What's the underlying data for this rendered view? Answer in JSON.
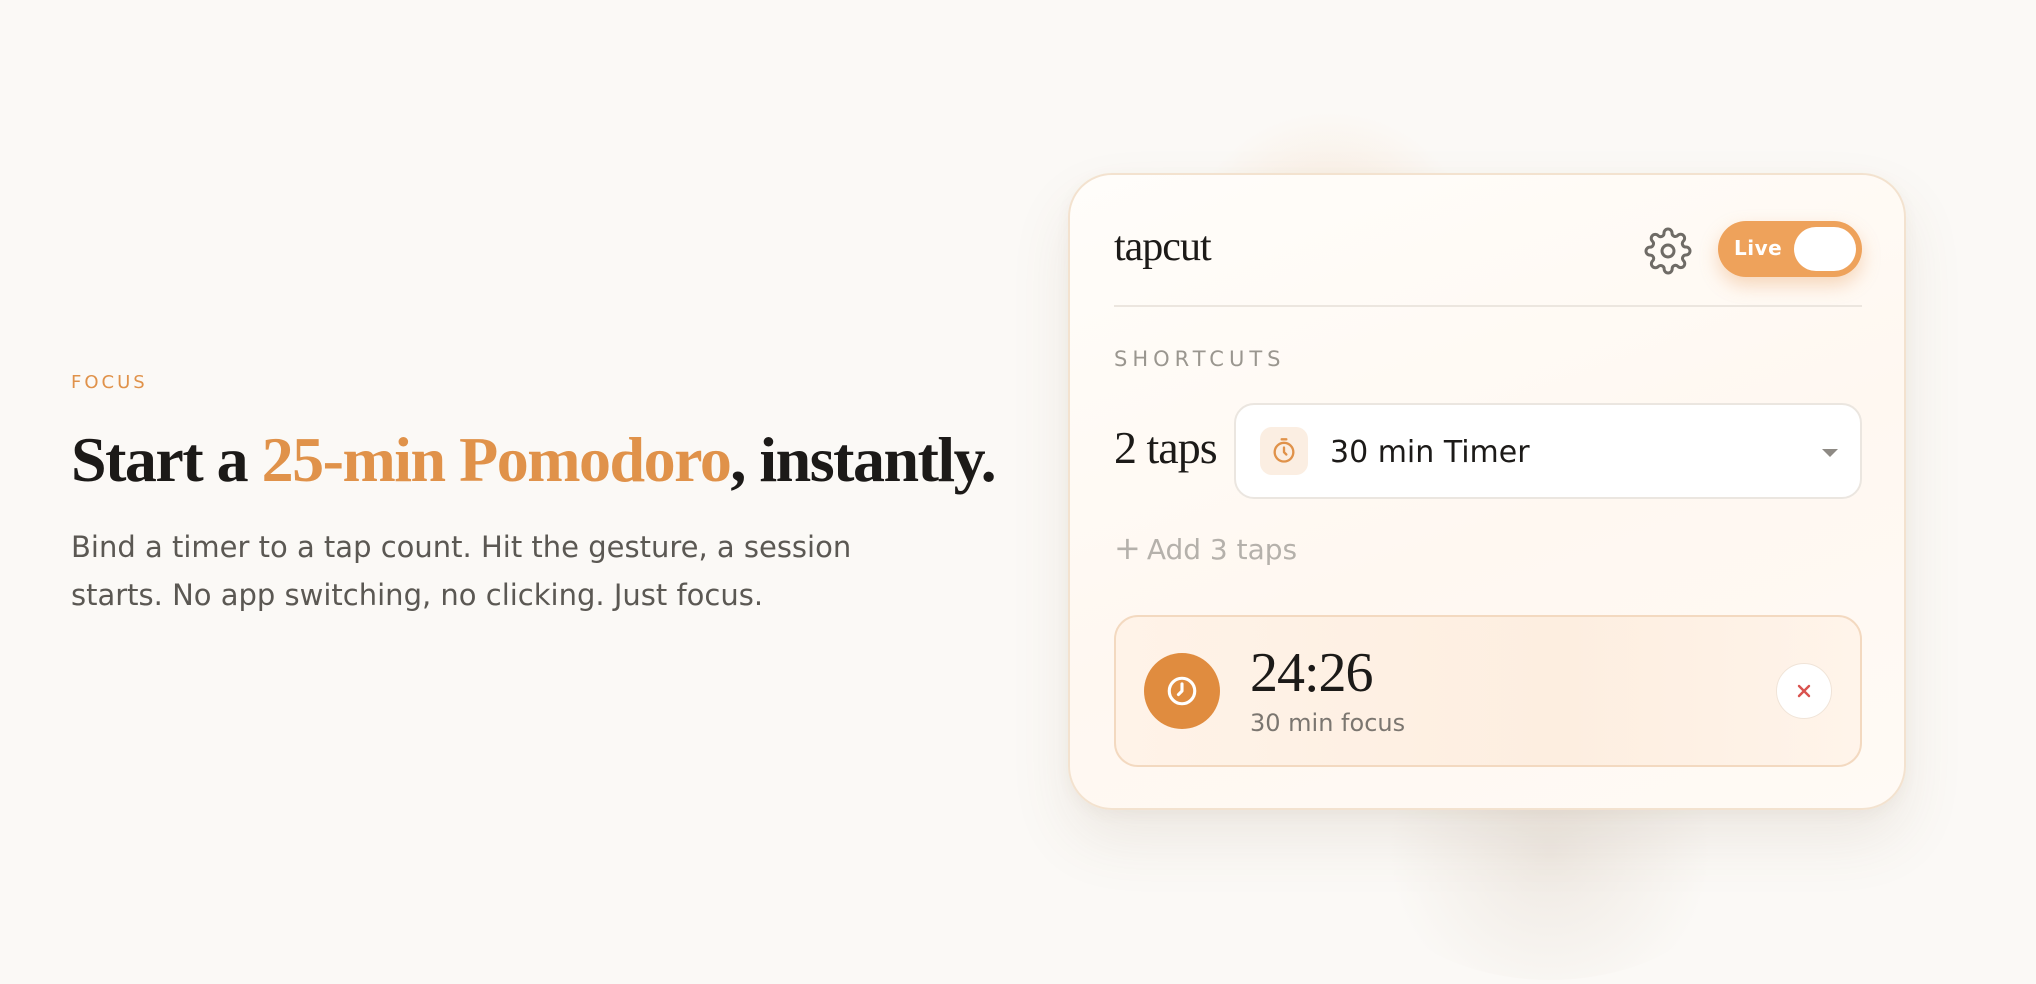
{
  "hero": {
    "eyebrow": "FOCUS",
    "headline_pre": "Start a ",
    "headline_accent": "25-min Pomodoro",
    "headline_post": ", instantly.",
    "body": "Bind a timer to a tap count. Hit the gesture, a session starts. No app switching, no clicking. Just focus."
  },
  "card": {
    "brand": "tapcut",
    "settings_icon": "gear-icon",
    "live_toggle": {
      "label": "Live",
      "on": true
    },
    "section_label": "SHORTCUTS",
    "shortcuts": [
      {
        "taps_label": "2 taps",
        "icon": "stopwatch-icon",
        "action": "30 min Timer"
      }
    ],
    "add_label": "Add 3 taps",
    "session": {
      "icon": "clock-icon",
      "time": "24:26",
      "subtitle": "30 min focus",
      "close_icon": "close-icon"
    }
  },
  "colors": {
    "accent": "#e0924a",
    "toggle": "#eea25b",
    "background": "#fbf9f6",
    "close": "#d9534f"
  }
}
